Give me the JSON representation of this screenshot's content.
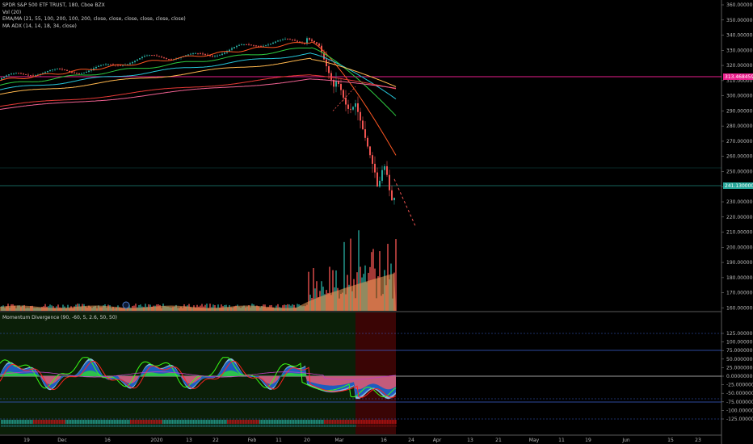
{
  "legend": {
    "title": "SPDR S&P 500 ETF TRUST, 180, Cboe BZX",
    "vol": "Vol (20)",
    "ema": "EMA/MA (21, 55, 100, 200, 100, 200, close, close, close, close, close, close)",
    "adx": "MA ADX (14, 14, 18, 34, close)"
  },
  "oscillator": {
    "label": "Momentum Divergence (90, -60, 5, 2.6, 50, 50)"
  },
  "price_axis": {
    "ticks": [
      "360.00000000",
      "350.00000000",
      "340.00000000",
      "330.00000000",
      "320.00000000",
      "310.00000000",
      "300.00000000",
      "290.00000000",
      "280.00000000",
      "270.00000000",
      "260.00000000",
      "250.00000000",
      "240.00000000",
      "230.00000000",
      "220.00000000",
      "210.00000000",
      "200.00000000",
      "190.00000000",
      "180.00000000",
      "170.00000000",
      "160.00000000"
    ],
    "badge_magenta": "313.46845981",
    "badge_teal": "241.13000000"
  },
  "osc_axis": {
    "ticks": [
      "125.00000000",
      "100.00000000",
      "75.00000000",
      "50.00000000",
      "25.00000000",
      "0.00000000",
      "-25.00000000",
      "-50.00000000",
      "-75.00000000",
      "-100.00000000",
      "-125.00000000"
    ]
  },
  "time_axis": {
    "ticks": [
      "19",
      "Dec",
      "16",
      "2020",
      "13",
      "22",
      "Feb",
      "11",
      "20",
      "Mar",
      "16",
      "24",
      "Apr",
      "13",
      "21",
      "May",
      "11",
      "19",
      "Jun",
      "15",
      "23"
    ]
  },
  "colors": {
    "background": "#000000",
    "magenta_line": "#e91e8c",
    "teal_line": "#26a69a",
    "volume_up": "#26a69a",
    "volume_down": "#ef5350",
    "volume_ma": "#f4a05a",
    "osc_blue": "#1e5dbf",
    "osc_lightblue": "#90c8f0",
    "osc_green": "#2ecc40",
    "osc_red": "#e05a6e",
    "osc_bg_green": "#0b1f08",
    "osc_bg_red": "#3a0505"
  }
}
